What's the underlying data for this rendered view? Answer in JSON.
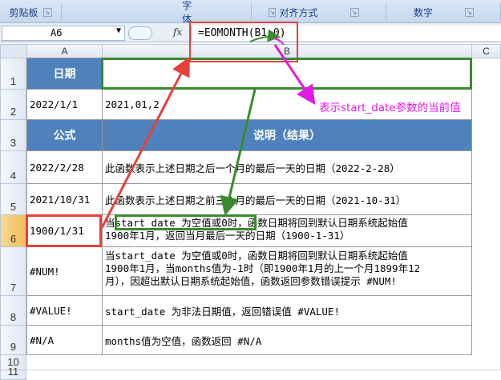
{
  "ribbon": {
    "groups": [
      "剪贴板",
      "字体",
      "对齐方式",
      "数字"
    ]
  },
  "formula_bar": {
    "name_box": "A6",
    "fx_label": "fx",
    "formula": "=EOMONTH(B1,0)"
  },
  "columns": [
    "A",
    "B",
    "C"
  ],
  "rows": [
    "1",
    "2",
    "3",
    "4",
    "5",
    "6",
    "7",
    "8",
    "9",
    "10",
    "11"
  ],
  "cells": {
    "a1": "日期",
    "b1": "",
    "a2": "2022/1/1",
    "b2": "2021,01,2",
    "a3": "公式",
    "b3": "说明（结果）",
    "a4": "2022/2/28",
    "b4": "此函数表示上述日期之后一个月的最后一天的日期（2022-2-28）",
    "a5": "2021/10/31",
    "b5": "此函数表示上述日期之前三个月的最后一天的日期（2021-10-31）",
    "a6": "1900/1/31",
    "b6": "当start_date 为空值或0时，函数日期将回到默认日期系统起始值\n1900年1月，返回当月最后一天的日期（1900-1-31）",
    "a7": "#NUM!",
    "b7": "当start_date 为空值或0时，函数日期将回到默认日期系统起始值\n1900年1月，当months值为-1时（即1900年1月的上一个月1899年12\n月），因超出默认日期系统起始值，函数返回参数错误提示 #NUM!",
    "a8": "#VALUE!",
    "b8": "start_date 为非法日期值，返回错误值 #VALUE!",
    "a9": "#N/A",
    "b9": "months值为空值，函数返回 #N/A"
  },
  "annotation": {
    "text": "表示start_date参数的当前值"
  },
  "colors": {
    "header_fill": "#4f81bd",
    "red_box": "#e8403a",
    "green_box": "#3c8a2e",
    "magenta": "#e21adf"
  }
}
